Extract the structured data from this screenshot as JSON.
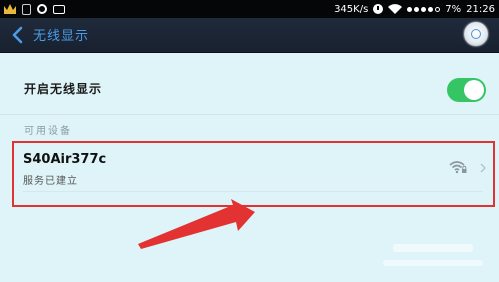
{
  "status_bar": {
    "network_speed": "345K/s",
    "battery": "7%",
    "time": "21:26",
    "icons": [
      "crown-icon",
      "lock-icon",
      "ring-icon",
      "box-icon",
      "clock-icon",
      "wifi-icon",
      "signal-dots-icon"
    ]
  },
  "header": {
    "title": "无线显示",
    "back_icon": "back-chevron-icon",
    "right_icon": "settings-circle-icon"
  },
  "toggle": {
    "label": "开启无线显示",
    "enabled": true,
    "on_color": "#35c564"
  },
  "section": {
    "label": "可用设备"
  },
  "devices": [
    {
      "name": "S40Air377c",
      "status": "服务已建立",
      "icons": [
        "wifi-locked-icon",
        "chevron-right-icon"
      ]
    }
  ],
  "annotation": {
    "highlight_color": "#e23232",
    "arrow_color": "#e23232"
  },
  "colors": {
    "header_bg": "#1f2a3b",
    "title_color": "#4a9de8",
    "page_bg": "#dff4f9"
  }
}
